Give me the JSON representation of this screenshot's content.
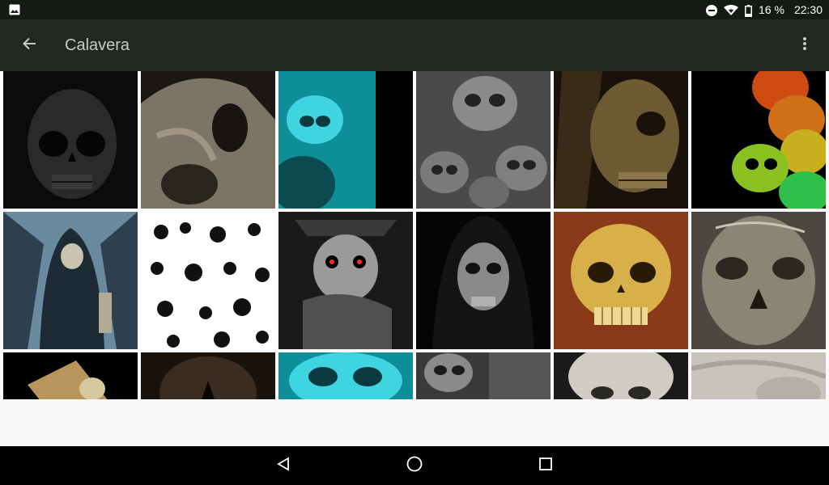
{
  "status_bar": {
    "notification_icon": "image-icon",
    "dnd_icon": "do-not-disturb-icon",
    "wifi_icon": "wifi-icon",
    "battery_icon": "battery-icon",
    "battery_text": "16 %",
    "time": "22:30"
  },
  "app_bar": {
    "back_icon": "arrow-back-icon",
    "title": "Calavera",
    "menu_icon": "more-vert-icon"
  },
  "gallery": {
    "rows": [
      [
        "dark-skull",
        "bone-skull-closeup",
        "cyan-skull",
        "grey-skulls-pile",
        "brown-hooded-skull",
        "rainbow-skulls"
      ],
      [
        "grim-reaper-throne",
        "cartoon-skull-pattern",
        "red-eyed-skull-snake",
        "hooded-reaper",
        "golden-skull",
        "sketched-skull"
      ],
      [
        "skull-playing-cards",
        "dark-skull-face",
        "cyan-skull-partial",
        "grey-skulls-partial",
        "white-skull-partial",
        "white-bone-partial"
      ]
    ]
  },
  "nav_bar": {
    "back_icon": "nav-back-triangle-icon",
    "home_icon": "nav-home-circle-icon",
    "recents_icon": "nav-recents-square-icon"
  },
  "colors": {
    "status_bar": "#161a15",
    "app_bar": "#222820",
    "title_text": "#c7cbc6",
    "background": "#fafafa",
    "nav_bar": "#000000"
  }
}
